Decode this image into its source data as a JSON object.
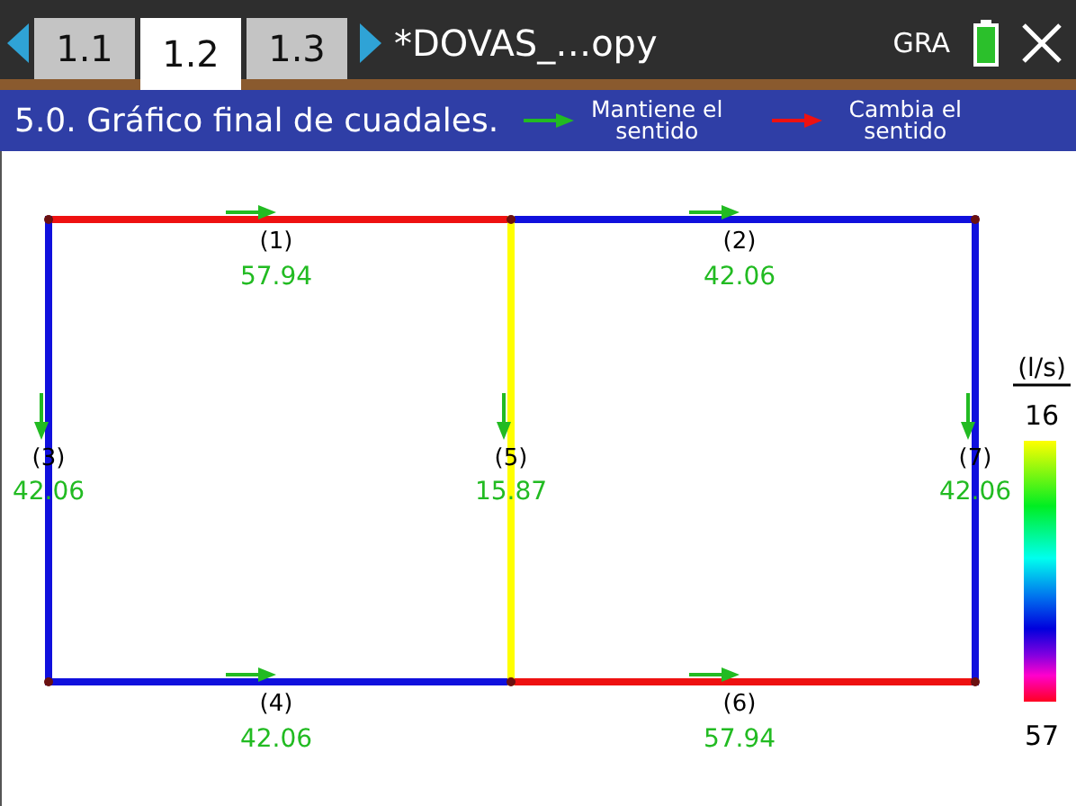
{
  "top_bar": {
    "tabs": [
      {
        "label": "1.1",
        "selected": false
      },
      {
        "label": "1.2",
        "selected": true
      },
      {
        "label": "1.3",
        "selected": false
      }
    ],
    "document_title": "*DOVAS_…opy",
    "mode": "GRA"
  },
  "title_bar": {
    "title": "5.0. Gráfico final de cuadales.",
    "legend": [
      {
        "label": "Mantiene el sentido",
        "color": "#22bb22"
      },
      {
        "label": "Cambia el sentido",
        "color": "#ee1111"
      }
    ]
  },
  "graph": {
    "edges": [
      {
        "label": "(1)",
        "value": "57.94",
        "color": "#ee1111"
      },
      {
        "label": "(2)",
        "value": "42.06",
        "color": "#1010dd"
      },
      {
        "label": "(3)",
        "value": "42.06",
        "color": "#1010dd"
      },
      {
        "label": "(4)",
        "value": "42.06",
        "color": "#1010dd"
      },
      {
        "label": "(5)",
        "value": "15.87",
        "color": "#ffff00"
      },
      {
        "label": "(6)",
        "value": "57.94",
        "color": "#ee1111"
      },
      {
        "label": "(7)",
        "value": "42.06",
        "color": "#1010dd"
      }
    ],
    "color_scale": {
      "unit": "(l/s)",
      "max": "16",
      "min": "57"
    }
  }
}
